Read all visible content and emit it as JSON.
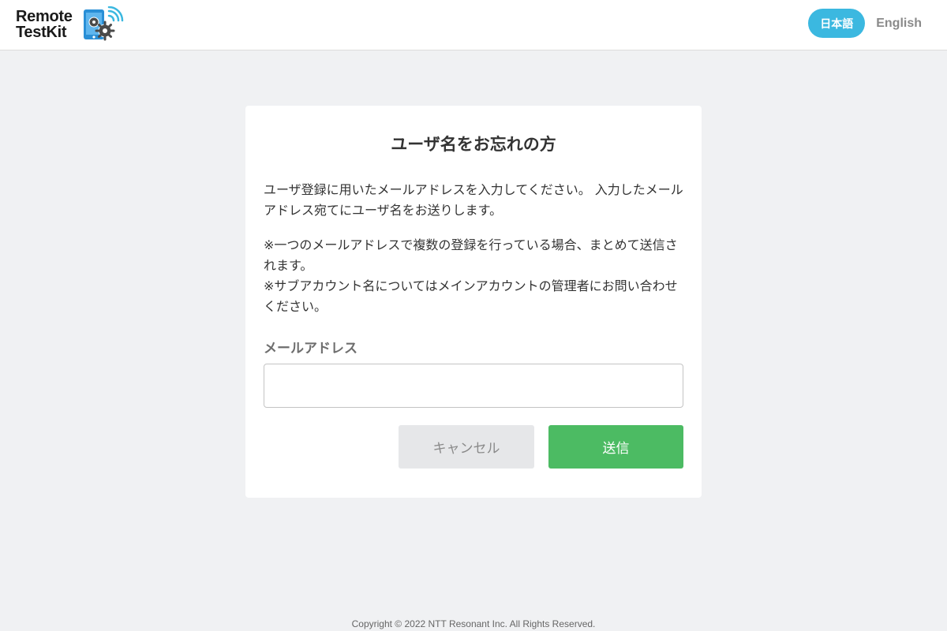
{
  "header": {
    "logo": {
      "line1": "Remote",
      "line2": "TestKit",
      "icon": "device-gears-signal-icon"
    },
    "language": {
      "japanese_label": "日本語",
      "english_label": "English",
      "active": "日本語"
    }
  },
  "form": {
    "title": "ユーザ名をお忘れの方",
    "description": "ユーザ登録に用いたメールアドレスを入力してください。 入力したメールアドレス宛てにユーザ名をお送りします。",
    "notes": [
      "※一つのメールアドレスで複数の登録を行っている場合、まとめて送信されます。",
      "※サブアカウント名についてはメインアカウントの管理者にお問い合わせください。"
    ],
    "email_label": "メールアドレス",
    "email_value": "",
    "cancel_label": "キャンセル",
    "submit_label": "送信"
  },
  "footer": {
    "copyright": "Copyright © 2022 NTT Resonant Inc. All Rights Reserved."
  },
  "colors": {
    "accent_blue": "#3bb8e0",
    "submit_green": "#4cbb63",
    "background": "#f0f1f3"
  }
}
